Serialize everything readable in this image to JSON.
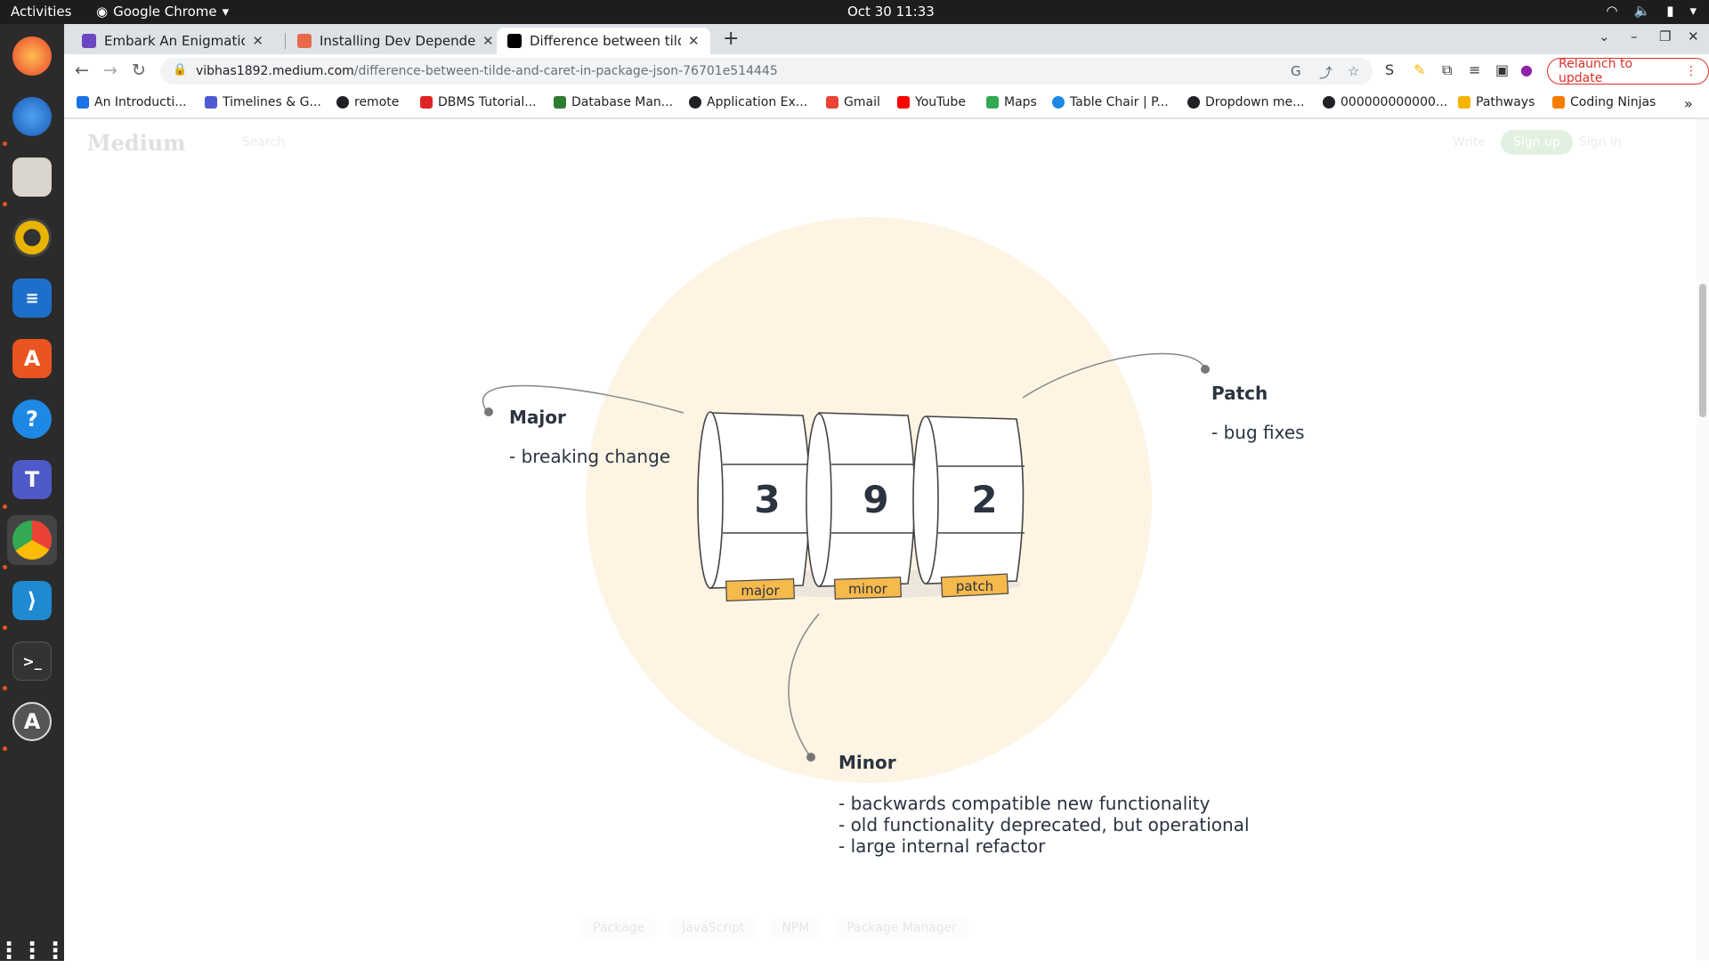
{
  "system": {
    "activities": "Activities",
    "app_name": "Google Chrome",
    "clock": "Oct 30  11:33"
  },
  "tabs": [
    {
      "title": "Embark An Enigmatic Jou",
      "color": "#6b46c1"
    },
    {
      "title": "Installing Dev Dependenc",
      "color": "#e66a4a"
    },
    {
      "title": "Difference between tilde",
      "color": "#000000"
    }
  ],
  "omnibox": {
    "host": "vibhas1892.medium.com",
    "path": "/difference-between-tilde-and-caret-in-package-json-76701e514445"
  },
  "relaunch_label": "Relaunch to update",
  "bookmarks": [
    {
      "label": "An Introducti...",
      "color": "#1a73e8"
    },
    {
      "label": "Timelines & G...",
      "color": "#4f5bd5"
    },
    {
      "label": "remote",
      "color": "#202124"
    },
    {
      "label": "DBMS Tutorial...",
      "color": "#e02424"
    },
    {
      "label": "Database Man...",
      "color": "#2e7d32"
    },
    {
      "label": "Application Ex...",
      "color": "#202124"
    },
    {
      "label": "Gmail",
      "color": "#ea4335"
    },
    {
      "label": "YouTube",
      "color": "#ff0000"
    },
    {
      "label": "Maps",
      "color": "#34a853"
    },
    {
      "label": "Table Chair | P...",
      "color": "#1e88e5"
    },
    {
      "label": "Dropdown me...",
      "color": "#202124"
    },
    {
      "label": "000000000000...",
      "color": "#202124"
    },
    {
      "label": "Pathways",
      "color": "#f4b400"
    },
    {
      "label": "Coding Ninjas",
      "color": "#f57c00"
    }
  ],
  "medium_header": {
    "logo": "Medium",
    "search": "Search",
    "write": "Write",
    "signup": "Sign up",
    "signin": "Sign in"
  },
  "diagram": {
    "circle_color": "#fdf4e3",
    "tag_color": "#f6b94c",
    "major": {
      "title": "Major",
      "desc": "- breaking change"
    },
    "patch": {
      "title": "Patch",
      "desc": "- bug fixes"
    },
    "minor": {
      "title": "Minor",
      "desc": [
        "- backwards compatible new functionality",
        "- old functionality deprecated, but operational",
        "- large internal refactor"
      ]
    },
    "digits": {
      "major": "3",
      "minor": "9",
      "patch": "2"
    },
    "tags": {
      "major": "major",
      "minor": "minor",
      "patch": "patch"
    }
  },
  "article_tags": [
    "Package",
    "JavaScript",
    "NPM",
    "Package Manager"
  ]
}
